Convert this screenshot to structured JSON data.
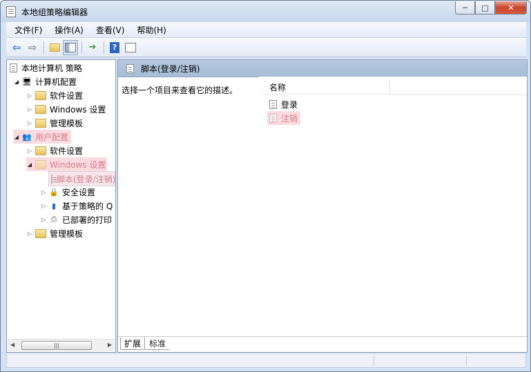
{
  "window": {
    "title": "本地组策略编辑器"
  },
  "menu": {
    "items": [
      "文件(F)",
      "操作(A)",
      "查看(V)",
      "帮助(H)"
    ]
  },
  "toolbar": {
    "buttons": [
      "back",
      "forward",
      "up-folder",
      "show-hide-tree",
      "export-list",
      "help",
      "properties"
    ]
  },
  "tree": {
    "root": "本地计算机 策略",
    "computer_config": "计算机配置",
    "cc_software": "软件设置",
    "cc_windows": "Windows 设置",
    "cc_templates": "管理模板",
    "user_config": "用户配置",
    "uc_software": "软件设置",
    "uc_windows": "Windows 设置",
    "uc_scripts": "脚本(登录/注销)",
    "uc_security": "安全设置",
    "uc_qos": "基于策略的 Q",
    "uc_printers": "已部署的打印",
    "uc_templates": "管理模板"
  },
  "right_pane": {
    "header_title": "脚本(登录/注销)",
    "description": "选择一个项目来查看它的描述。",
    "column_name": "名称",
    "items": [
      "登录",
      "注销"
    ]
  },
  "tabs": {
    "extended": "扩展",
    "standard": "标准"
  },
  "colors": {
    "highlight_bg": "#fbdbe0",
    "highlight_text": "#d37d8b",
    "header_blue": "#a7bdd7"
  }
}
